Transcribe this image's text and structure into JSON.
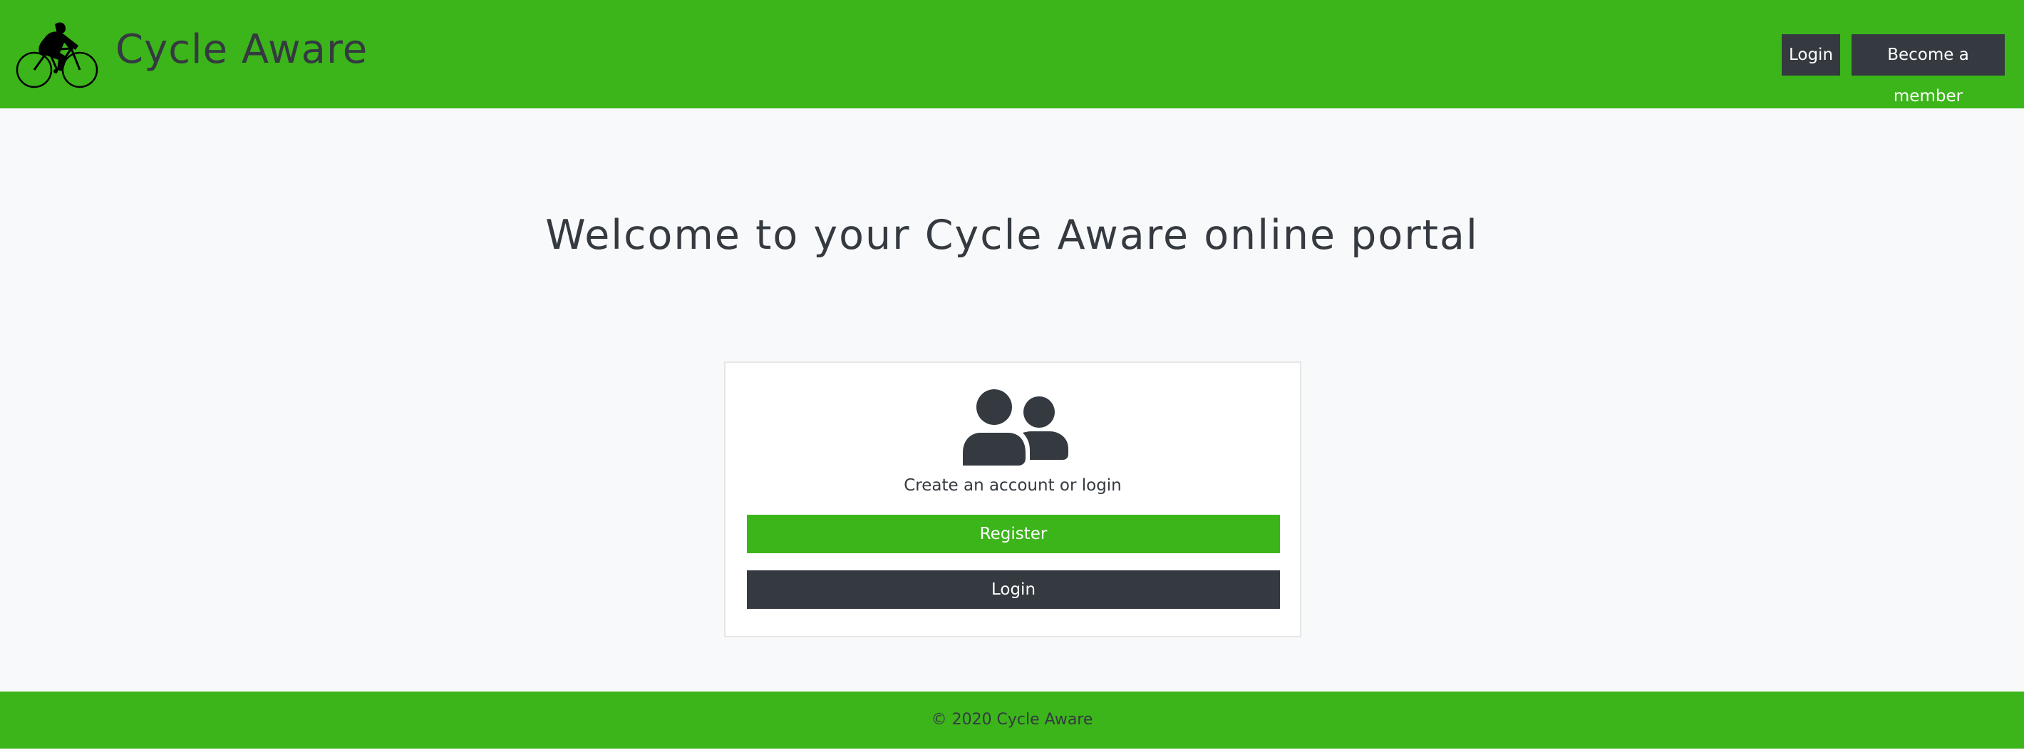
{
  "brand": {
    "name": "Cycle Aware",
    "logo_icon": "cyclist-icon"
  },
  "nav": {
    "login_label": "Login",
    "member_label": "Become a member"
  },
  "main": {
    "heading": "Welcome to your Cycle Aware online portal"
  },
  "card": {
    "icon": "users-icon",
    "text": "Create an account or login",
    "register_label": "Register",
    "login_label": "Login"
  },
  "footer": {
    "text": "© 2020 Cycle Aware"
  },
  "colors": {
    "brand_green": "#3cb51b",
    "dark": "#343a40",
    "background": "#f8f9fa"
  }
}
